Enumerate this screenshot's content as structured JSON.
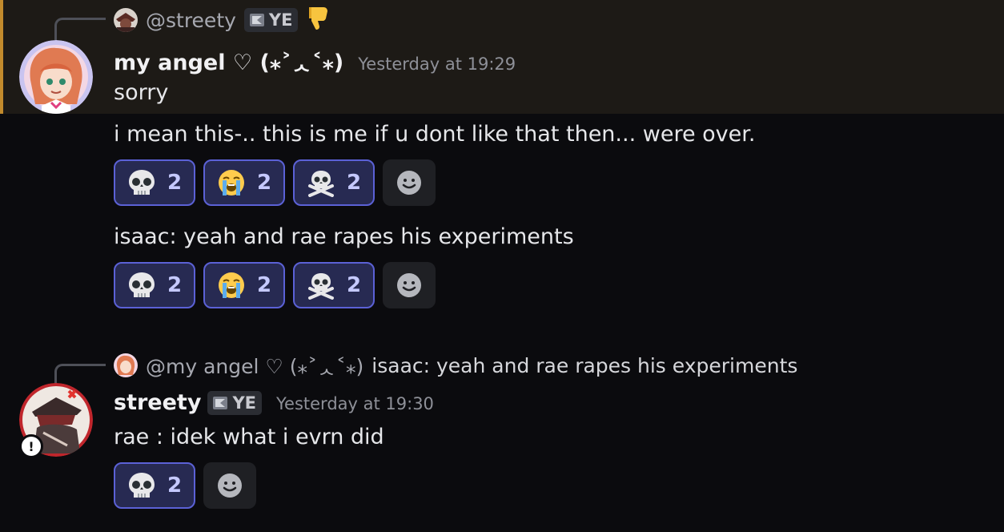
{
  "messages": [
    {
      "reply": {
        "name": "@streety",
        "tag": "YE"
      },
      "username": "my angel ♡ (⁎˃ᆺ˂⁎)",
      "timestamp": "Yesterday at 19:29",
      "lines": [
        "sorry"
      ]
    },
    {
      "text": "i mean this-.. this is me if u dont like that then... were over.",
      "reactions": [
        {
          "emoji": "skull-emoji",
          "count": "2"
        },
        {
          "emoji": "loudly-crying-emoji",
          "count": "2"
        },
        {
          "emoji": "skull-crossbones-emoji",
          "count": "2"
        }
      ]
    },
    {
      "text": "isaac:  yeah and rae rapes his experiments",
      "reactions": [
        {
          "emoji": "skull-emoji",
          "count": "2"
        },
        {
          "emoji": "loudly-crying-emoji",
          "count": "2"
        },
        {
          "emoji": "skull-crossbones-emoji",
          "count": "2"
        }
      ]
    },
    {
      "reply": {
        "name": "@my angel ♡ (⁎˃ᆺ˂⁎)",
        "text": "isaac:  yeah and rae rapes his experiments"
      },
      "username": "streety",
      "tag": "YE",
      "timestamp": "Yesterday at 19:30",
      "lines": [
        "rae : idek what i evrn did"
      ],
      "reactions": [
        {
          "emoji": "skull-emoji",
          "count": "2"
        }
      ]
    }
  ],
  "colors": {
    "background": "#0b0b0e",
    "highlight": "#1d1a16",
    "highlight_border": "#c28a2c",
    "reaction_border": "#5b61d6",
    "reaction_bg": "#272a52"
  }
}
